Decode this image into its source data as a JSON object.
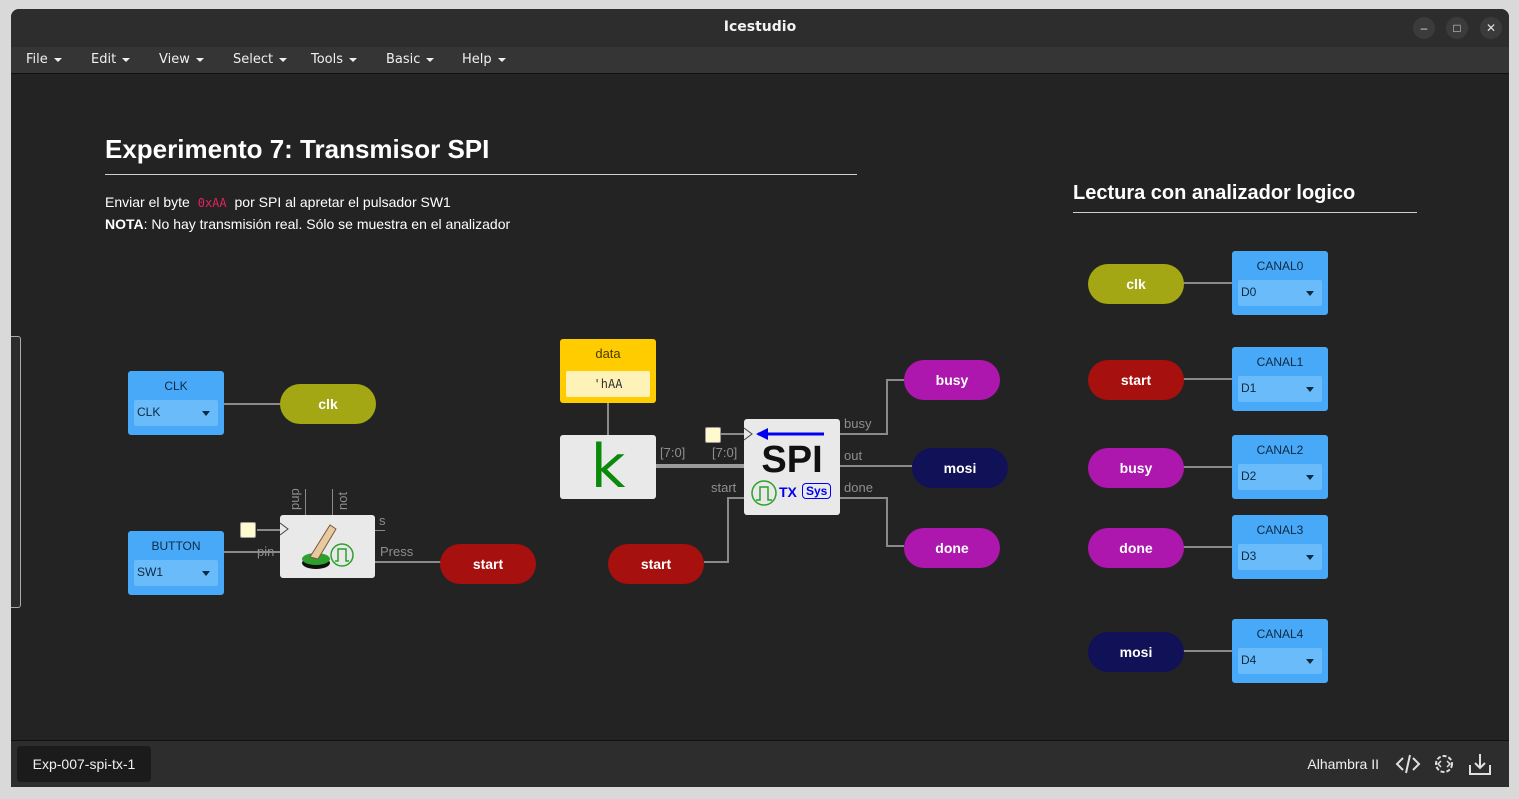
{
  "app": {
    "title": "Icestudio"
  },
  "window_controls": {
    "minimize": "–",
    "maximize": "□",
    "close": "✕"
  },
  "menu": [
    "File",
    "Edit",
    "View",
    "Select",
    "Tools",
    "Basic",
    "Help"
  ],
  "doc": {
    "heading": "Experimento 7: Transmisor SPI",
    "desc1_before": "Enviar el byte",
    "desc1_code": "0xAA",
    "desc1_after": "por SPI al apretar el pulsador SW1",
    "nota_label": "NOTA",
    "nota_text": ": No hay transmisión real. Sólo se muestra en el analizador"
  },
  "analyzer": {
    "heading": "Lectura con analizador logico"
  },
  "blocks": {
    "clk_input": {
      "label": "CLK",
      "value": "CLK"
    },
    "button_input": {
      "label": "BUTTON",
      "value": "SW1"
    },
    "data_param": {
      "label": "data",
      "value": "'hAA"
    },
    "const_symbol": "k",
    "spi": {
      "title": "SPI",
      "tx": "TX",
      "sys": "Sys"
    }
  },
  "labels": {
    "clk": "clk",
    "start": "start",
    "busy": "busy",
    "mosi": "mosi",
    "done": "done"
  },
  "ports": {
    "pup": "pup",
    "not": "not",
    "s": "s",
    "pin": "pin",
    "press": "Press",
    "bus_out": "[7:0]",
    "bus_in": "[7:0]",
    "busy": "busy",
    "out": "out",
    "done": "done",
    "start": "start"
  },
  "channels": [
    {
      "label": "CANAL0",
      "value": "D0",
      "signal": "clk",
      "color": "#a4a714"
    },
    {
      "label": "CANAL1",
      "value": "D1",
      "signal": "start",
      "color": "#a6100e"
    },
    {
      "label": "CANAL2",
      "value": "D2",
      "signal": "busy",
      "color": "#ad17ad"
    },
    {
      "label": "CANAL3",
      "value": "D3",
      "signal": "done",
      "color": "#ad17ad"
    },
    {
      "label": "CANAL4",
      "value": "D4",
      "signal": "mosi",
      "color": "#111157"
    }
  ],
  "colors": {
    "clk": "#a4a714",
    "start": "#a6100e",
    "busy": "#ad17ad",
    "mosi": "#111157",
    "io_block": "#48a9f8",
    "param_block": "#ffcc00"
  },
  "footer": {
    "tab": "Exp-007-spi-tx-1",
    "board": "Alhambra II"
  },
  "icons": [
    "code-icon",
    "settings-code-icon",
    "upload-icon"
  ]
}
